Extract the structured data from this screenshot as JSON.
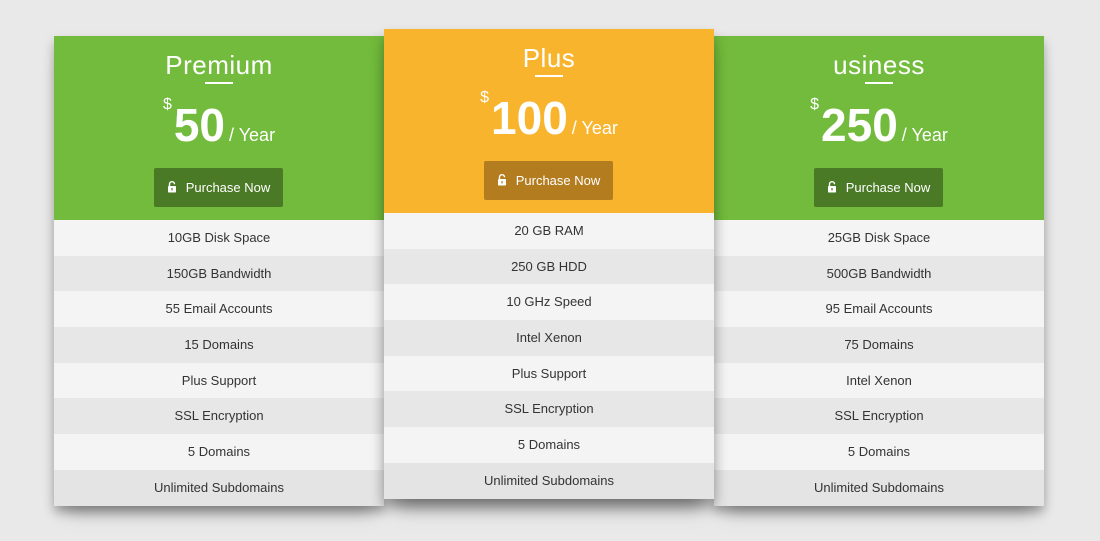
{
  "colors": {
    "page_background": "#e9e9e9",
    "green_accent": "#72bb3c",
    "green_button": "#4a7a26",
    "yellow_accent": "#f8b42d",
    "yellow_button": "#b27c1f"
  },
  "plans": [
    {
      "title": "Premium",
      "currency": "$",
      "amount": "50",
      "period": "/ Year",
      "button_label": "Purchase Now",
      "button_icon": "lock-icon",
      "features": [
        "10GB Disk Space",
        "150GB Bandwidth",
        "55 Email Accounts",
        "15 Domains",
        "Plus Support",
        "SSL Encryption",
        "5 Domains",
        "Unlimited Subdomains"
      ]
    },
    {
      "title": "Plus",
      "currency": "$",
      "amount": "100",
      "period": "/ Year",
      "button_label": "Purchase Now",
      "button_icon": "lock-icon",
      "features": [
        "20 GB RAM",
        "250 GB HDD",
        "10 GHz Speed",
        "Intel Xenon",
        "Plus Support",
        "SSL Encryption",
        "5 Domains",
        "Unlimited Subdomains"
      ]
    },
    {
      "title": "usiness",
      "currency": "$",
      "amount": "250",
      "period": "/ Year",
      "button_label": "Purchase Now",
      "button_icon": "lock-icon",
      "features": [
        "25GB Disk Space",
        "500GB Bandwidth",
        "95 Email Accounts",
        "75 Domains",
        "Intel Xenon",
        "SSL Encryption",
        "5 Domains",
        "Unlimited Subdomains"
      ]
    }
  ]
}
